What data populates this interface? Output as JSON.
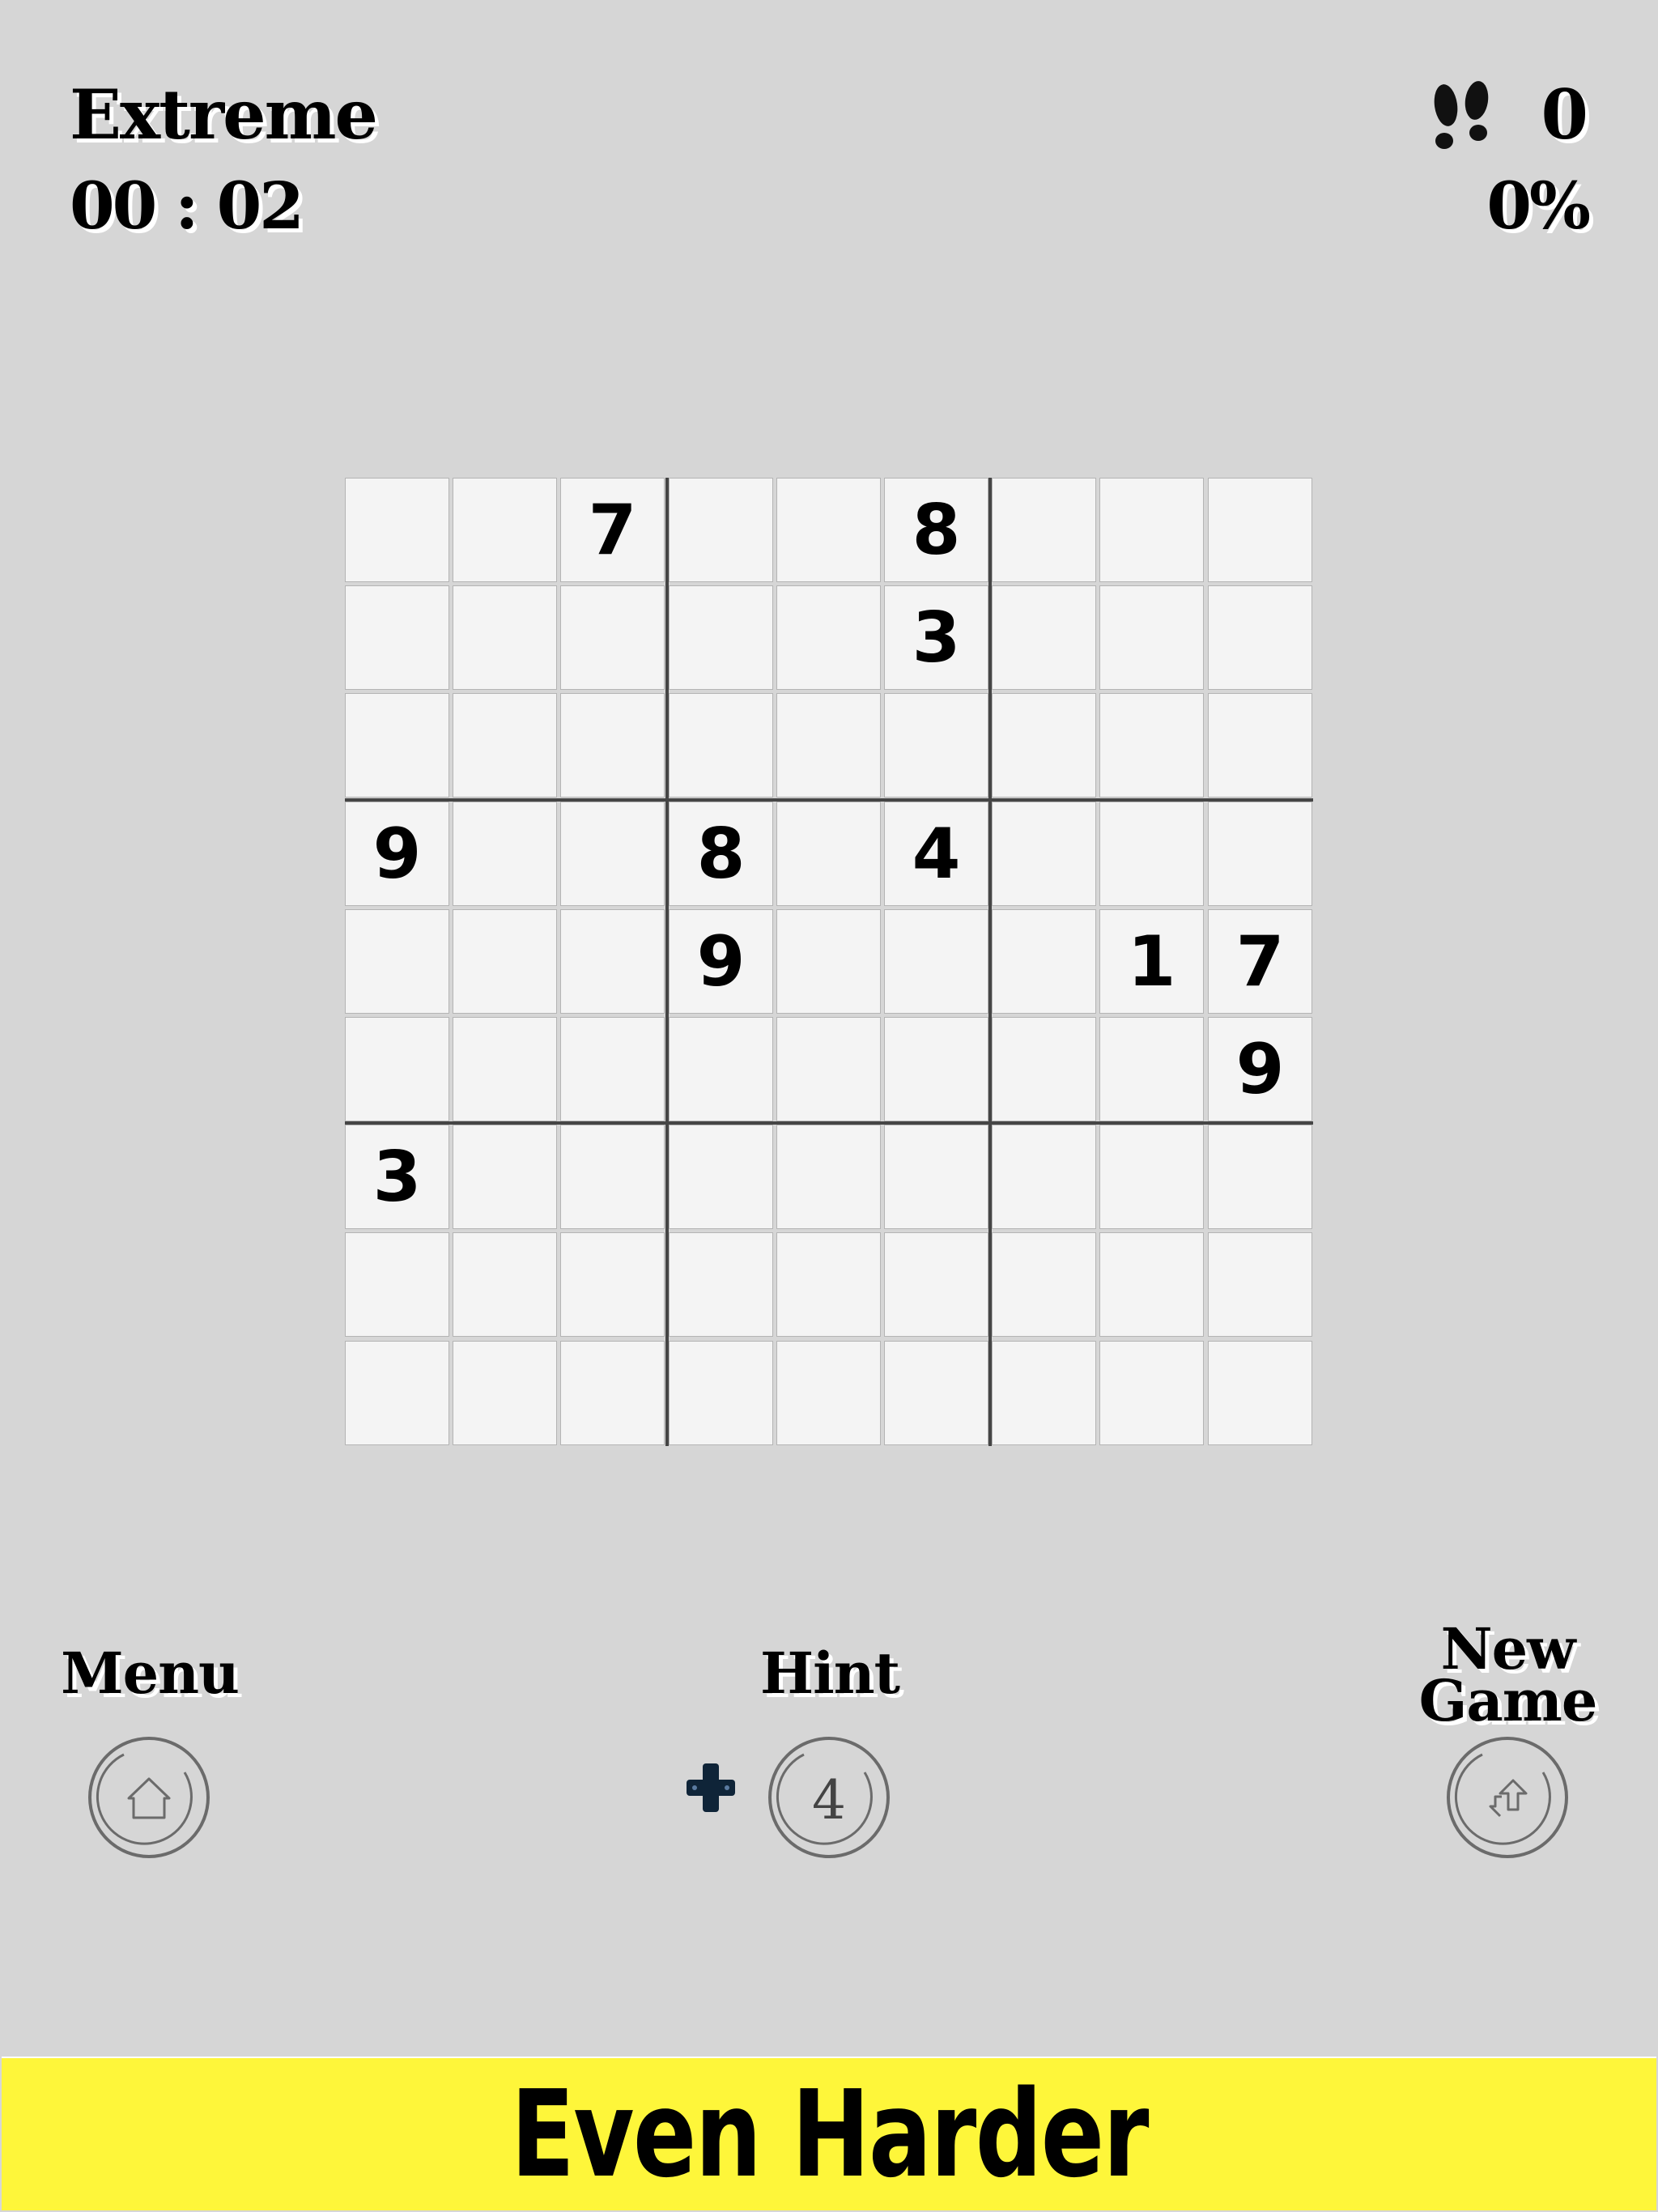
{
  "header": {
    "difficulty": "Extreme",
    "timer": "00 : 02",
    "steps_icon": "footprints-icon",
    "steps": "0",
    "progress": "0%"
  },
  "board": {
    "rows": [
      [
        "",
        "",
        "7",
        "",
        "",
        "8",
        "",
        "",
        ""
      ],
      [
        "",
        "",
        "",
        "",
        "",
        "3",
        "",
        "",
        ""
      ],
      [
        "",
        "",
        "",
        "",
        "",
        "",
        "",
        "",
        ""
      ],
      [
        "9",
        "",
        "",
        "8",
        "",
        "4",
        "",
        "",
        ""
      ],
      [
        "",
        "",
        "",
        "9",
        "",
        "",
        "",
        "1",
        "7"
      ],
      [
        "",
        "",
        "",
        "",
        "",
        "",
        "",
        "",
        "9"
      ],
      [
        "3",
        "",
        "",
        "",
        "",
        "",
        "",
        "",
        ""
      ],
      [
        "",
        "",
        "",
        "",
        "",
        "",
        "",
        "",
        ""
      ],
      [
        "",
        "",
        "",
        "",
        "",
        "",
        "",
        "",
        ""
      ]
    ]
  },
  "controls": {
    "menu_label": "Menu",
    "menu_icon": "home-icon",
    "hint_label": "Hint",
    "hint_count": "4",
    "add_hint_icon": "plus-icon",
    "new_game_label_line1": "New",
    "new_game_label_line2": "Game",
    "new_game_icon": "refresh-arrow-icon"
  },
  "banner": {
    "text": "Even Harder",
    "color": "#fef63a"
  }
}
